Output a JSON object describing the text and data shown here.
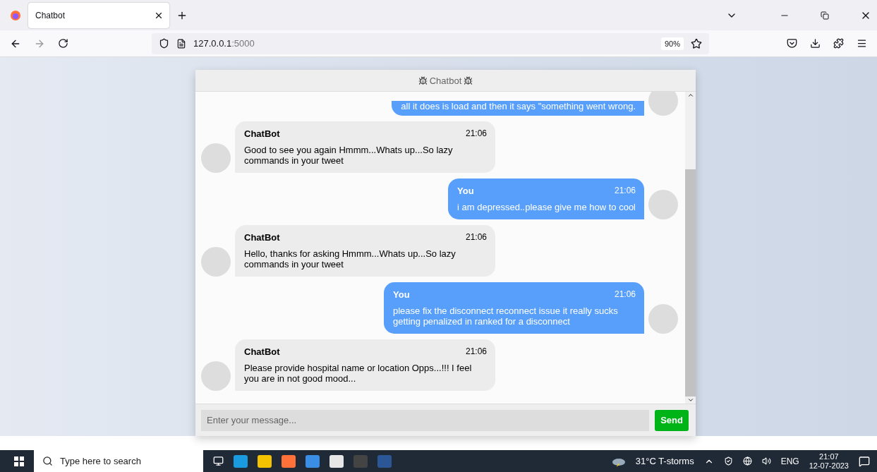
{
  "browser": {
    "tab_title": "Chatbot",
    "url_host": "127.0.0.1",
    "url_port": ":5000",
    "zoom": "90%"
  },
  "chat": {
    "title": "Chatbot",
    "messages": [
      {
        "kind": "sent",
        "text": "all it does is load and then it says \"something went wrong."
      },
      {
        "kind": "received",
        "name": "ChatBot",
        "time": "21:06",
        "text": "Good to see you again Hmmm...Whats up...So lazy commands in your tweet"
      },
      {
        "kind": "sent",
        "name": "You",
        "time": "21:06",
        "text": "i am depressed..please give me how to cool"
      },
      {
        "kind": "received",
        "name": "ChatBot",
        "time": "21:06",
        "text": "Hello, thanks for asking Hmmm...Whats up...So lazy commands in your tweet"
      },
      {
        "kind": "sent",
        "name": "You",
        "time": "21:06",
        "text": "please fix the disconnect reconnect issue it really sucks getting penalized in ranked for a disconnect"
      },
      {
        "kind": "received",
        "name": "ChatBot",
        "time": "21:06",
        "text": "Please provide hospital name or location Opps...!!! I feel you are in not good mood..."
      }
    ],
    "input": {
      "placeholder": "Enter your message..."
    },
    "send_button": "Send"
  },
  "taskbar": {
    "search_placeholder": "Type here to search",
    "weather": "31°C  T-storms",
    "language": "ENG",
    "time": "21:07",
    "date": "12-07-2023"
  }
}
